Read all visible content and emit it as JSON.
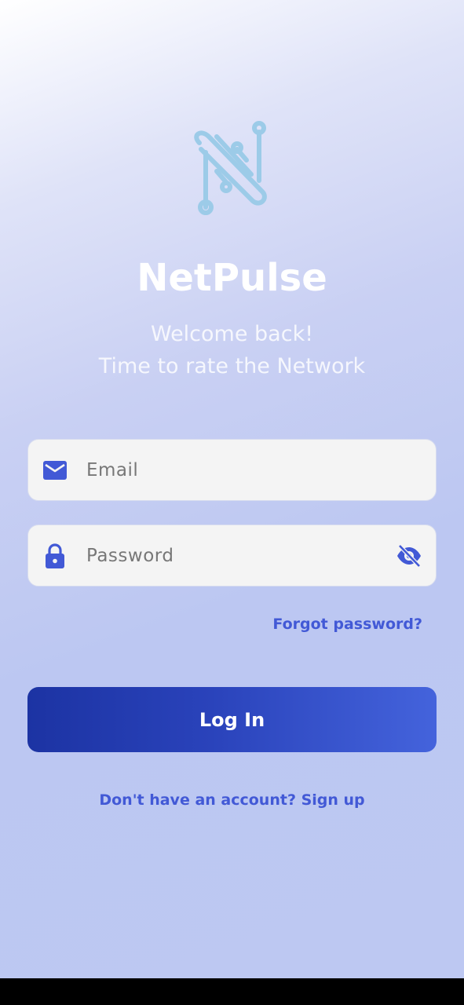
{
  "app": {
    "name": "NetPulse",
    "welcome_line1": "Welcome back!",
    "welcome_line2": "Time to rate the Network"
  },
  "form": {
    "email": {
      "placeholder": "Email",
      "value": "",
      "icon": "mail-icon"
    },
    "password": {
      "placeholder": "Password",
      "value": "",
      "icon": "lock-icon",
      "toggle_icon": "eye-off-icon"
    },
    "forgot_label": "Forgot password?",
    "login_label": "Log In",
    "signup_label": "Don't have an account? Sign up"
  },
  "colors": {
    "accent": "#4259d6",
    "button_start": "#1c33a3",
    "button_end": "#4463dc",
    "logo": "#9ccbe8",
    "field_bg": "#f4f4f4"
  }
}
